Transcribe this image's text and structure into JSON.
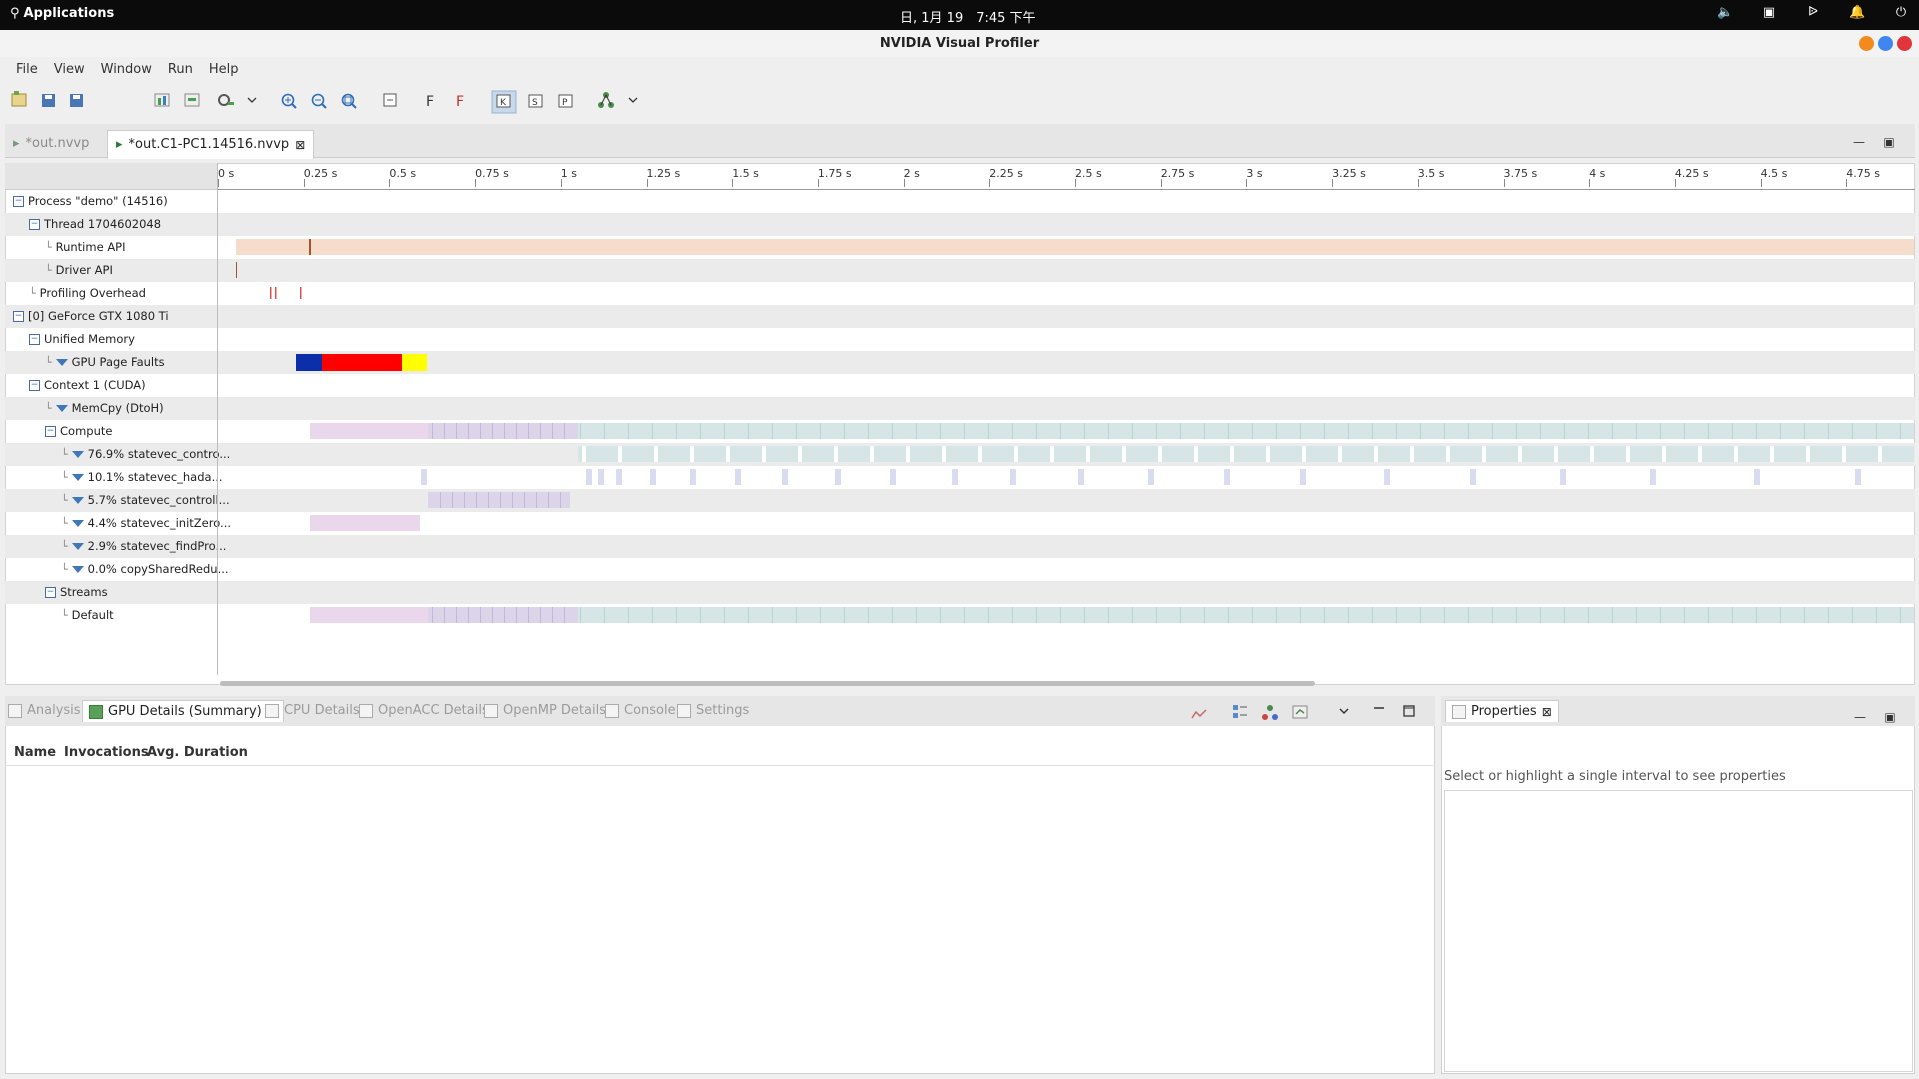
{
  "system": {
    "apps_label": "Applications",
    "clock": "日, 1月 19　7:45 下午"
  },
  "window": {
    "title": "NVIDIA Visual Profiler"
  },
  "menu": [
    "File",
    "View",
    "Window",
    "Run",
    "Help"
  ],
  "tabs": [
    {
      "label": "*out.nvvp",
      "active": false
    },
    {
      "label": "*out.C1-PC1.14516.nvvp",
      "active": true
    }
  ],
  "ruler": [
    "0 s",
    "0.25 s",
    "0.5 s",
    "0.75 s",
    "1 s",
    "1.25 s",
    "1.5 s",
    "1.75 s",
    "2 s",
    "2.25 s",
    "2.5 s",
    "2.75 s",
    "3 s",
    "3.25 s",
    "3.5 s",
    "3.75 s",
    "4 s",
    "4.25 s",
    "4.5 s",
    "4.75 s"
  ],
  "tree": [
    {
      "label": "Process \"demo\" (14516)",
      "indent": 0,
      "type": "minus"
    },
    {
      "label": "Thread 1704602048",
      "indent": 1,
      "type": "minus"
    },
    {
      "label": "Runtime API",
      "indent": 2,
      "type": "leaf"
    },
    {
      "label": "Driver API",
      "indent": 2,
      "type": "leaf"
    },
    {
      "label": "Profiling Overhead",
      "indent": 1,
      "type": "leaf"
    },
    {
      "label": "[0] GeForce GTX 1080 Ti",
      "indent": 0,
      "type": "minus"
    },
    {
      "label": "Unified Memory",
      "indent": 1,
      "type": "minus"
    },
    {
      "label": "GPU Page Faults",
      "indent": 2,
      "type": "filter"
    },
    {
      "label": "Context 1 (CUDA)",
      "indent": 1,
      "type": "minus"
    },
    {
      "label": "MemCpy (DtoH)",
      "indent": 2,
      "type": "filter"
    },
    {
      "label": "Compute",
      "indent": 2,
      "type": "minus"
    },
    {
      "label": "76.9% statevec_contro...",
      "indent": 3,
      "type": "filter"
    },
    {
      "label": "10.1% statevec_hada...",
      "indent": 3,
      "type": "filter"
    },
    {
      "label": "5.7% statevec_controll...",
      "indent": 3,
      "type": "filter"
    },
    {
      "label": "4.4% statevec_initZero...",
      "indent": 3,
      "type": "filter"
    },
    {
      "label": "2.9% statevec_findPro...",
      "indent": 3,
      "type": "filter"
    },
    {
      "label": "0.0% copySharedRedu...",
      "indent": 3,
      "type": "filter"
    },
    {
      "label": "Streams",
      "indent": 2,
      "type": "minus"
    },
    {
      "label": "Default",
      "indent": 3,
      "type": "leaf"
    }
  ],
  "bottom_tabs": [
    {
      "label": "Analysis",
      "active": false
    },
    {
      "label": "GPU Details (Summary)",
      "active": true
    },
    {
      "label": "CPU Details",
      "active": false
    },
    {
      "label": "OpenACC Details",
      "active": false
    },
    {
      "label": "OpenMP Details",
      "active": false
    },
    {
      "label": "Console",
      "active": false
    },
    {
      "label": "Settings",
      "active": false
    }
  ],
  "details_columns": [
    "Name",
    "Invocations",
    "Avg. Duration"
  ],
  "properties": {
    "tab": "Properties",
    "hint": "Select or highlight a single interval to see properties"
  },
  "colors": {
    "runtime": "#f6dccb",
    "fault_blue": "#0a2fa8",
    "fault_red": "#ff0000",
    "fault_yellow": "#ffff00",
    "compute_pink": "#ead7ec",
    "compute_lavender": "#dcd4e8",
    "compute_teal": "#d6e6e6",
    "hada": "#d9dcef"
  }
}
